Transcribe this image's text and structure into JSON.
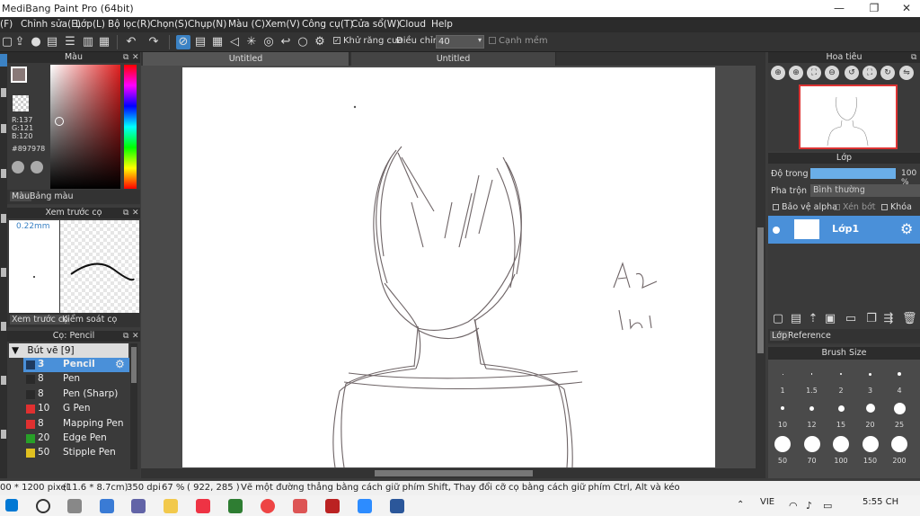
{
  "window": {
    "title": "MediBang Paint Pro (64bit)",
    "minimize": "—",
    "maximize": "❐",
    "close": "✕"
  },
  "menu": [
    "(F)",
    "Chỉnh sửa(E)",
    "Lớp(L)",
    "Bộ lọc(R)",
    "Chọn(S)",
    "Chụp(N)",
    "Màu (C)",
    "Xem(V)",
    "Công cụ(T)",
    "Cửa sổ(W)",
    "Cloud",
    "Help"
  ],
  "toolbar": {
    "antialias_label": "Khử răng cưa",
    "adjust_label": "Điều chỉnh",
    "adjust_value": "40",
    "edge_label": "Cạnh mềm"
  },
  "color_panel": {
    "title": "Màu",
    "r": "R:137",
    "g": "G:121",
    "b": "B:120",
    "hex": "#897978",
    "tab_color": "Màu",
    "tab_palette": "Bảng màu",
    "current_color": "#897978"
  },
  "preview_panel": {
    "title": "Xem trước cọ",
    "size": "0.22mm",
    "tab_preview": "Xem trước cọ",
    "tab_control": "Kiểm soát cọ"
  },
  "brush_panel": {
    "title": "Cọ: Pencil",
    "group": "Bút vẽ [9]",
    "items": [
      {
        "size": "3",
        "name": "Pencil",
        "color": "#1e3a5f"
      },
      {
        "size": "8",
        "name": "Pen",
        "color": "#2a2a2a"
      },
      {
        "size": "8",
        "name": "Pen (Sharp)",
        "color": "#2a2a2a"
      },
      {
        "size": "10",
        "name": "G Pen",
        "color": "#e03030"
      },
      {
        "size": "8",
        "name": "Mapping Pen",
        "color": "#e03030"
      },
      {
        "size": "20",
        "name": "Edge Pen",
        "color": "#28a028"
      },
      {
        "size": "50",
        "name": "Stipple Pen",
        "color": "#e0c020"
      }
    ]
  },
  "canvas_tabs": [
    "Untitled",
    "Untitled"
  ],
  "navigator": {
    "title": "Hoa tiêu"
  },
  "layer_panel": {
    "title": "Lớp",
    "opacity_label": "Độ trong",
    "opacity_value": "100 %",
    "blend_label": "Pha trộn",
    "blend_value": "Bình thường",
    "protect_alpha": "Bảo vệ alpha",
    "clipping": "Xén bớt",
    "lock": "Khóa",
    "layer_name": "Lớp1",
    "tab_layer": "Lớp",
    "tab_reference": "Reference"
  },
  "brush_size": {
    "title": "Brush Size",
    "sizes": [
      "1",
      "1.5",
      "2",
      "3",
      "4",
      "10",
      "12",
      "15",
      "20",
      "25",
      "50",
      "70",
      "100",
      "150",
      "200"
    ]
  },
  "status": {
    "dims": "00 * 1200 pixel",
    "cm": "(11.6 * 8.7cm)",
    "dpi": "350 dpi",
    "zoom": "67 %",
    "coords": "( 922, 285 )",
    "hint": "Vẽ một đường thẳng bằng cách giữ phím Shift, Thay đổi cỡ cọ bằng cách giữ phím Ctrl, Alt và kéo"
  },
  "taskbar": {
    "lang": "VIE",
    "time": "5:55 CH"
  },
  "canvas_text": [
    "An",
    "Ini"
  ],
  "colors": {
    "accent": "#3b82c4",
    "layer_selected": "#4a90d9"
  }
}
